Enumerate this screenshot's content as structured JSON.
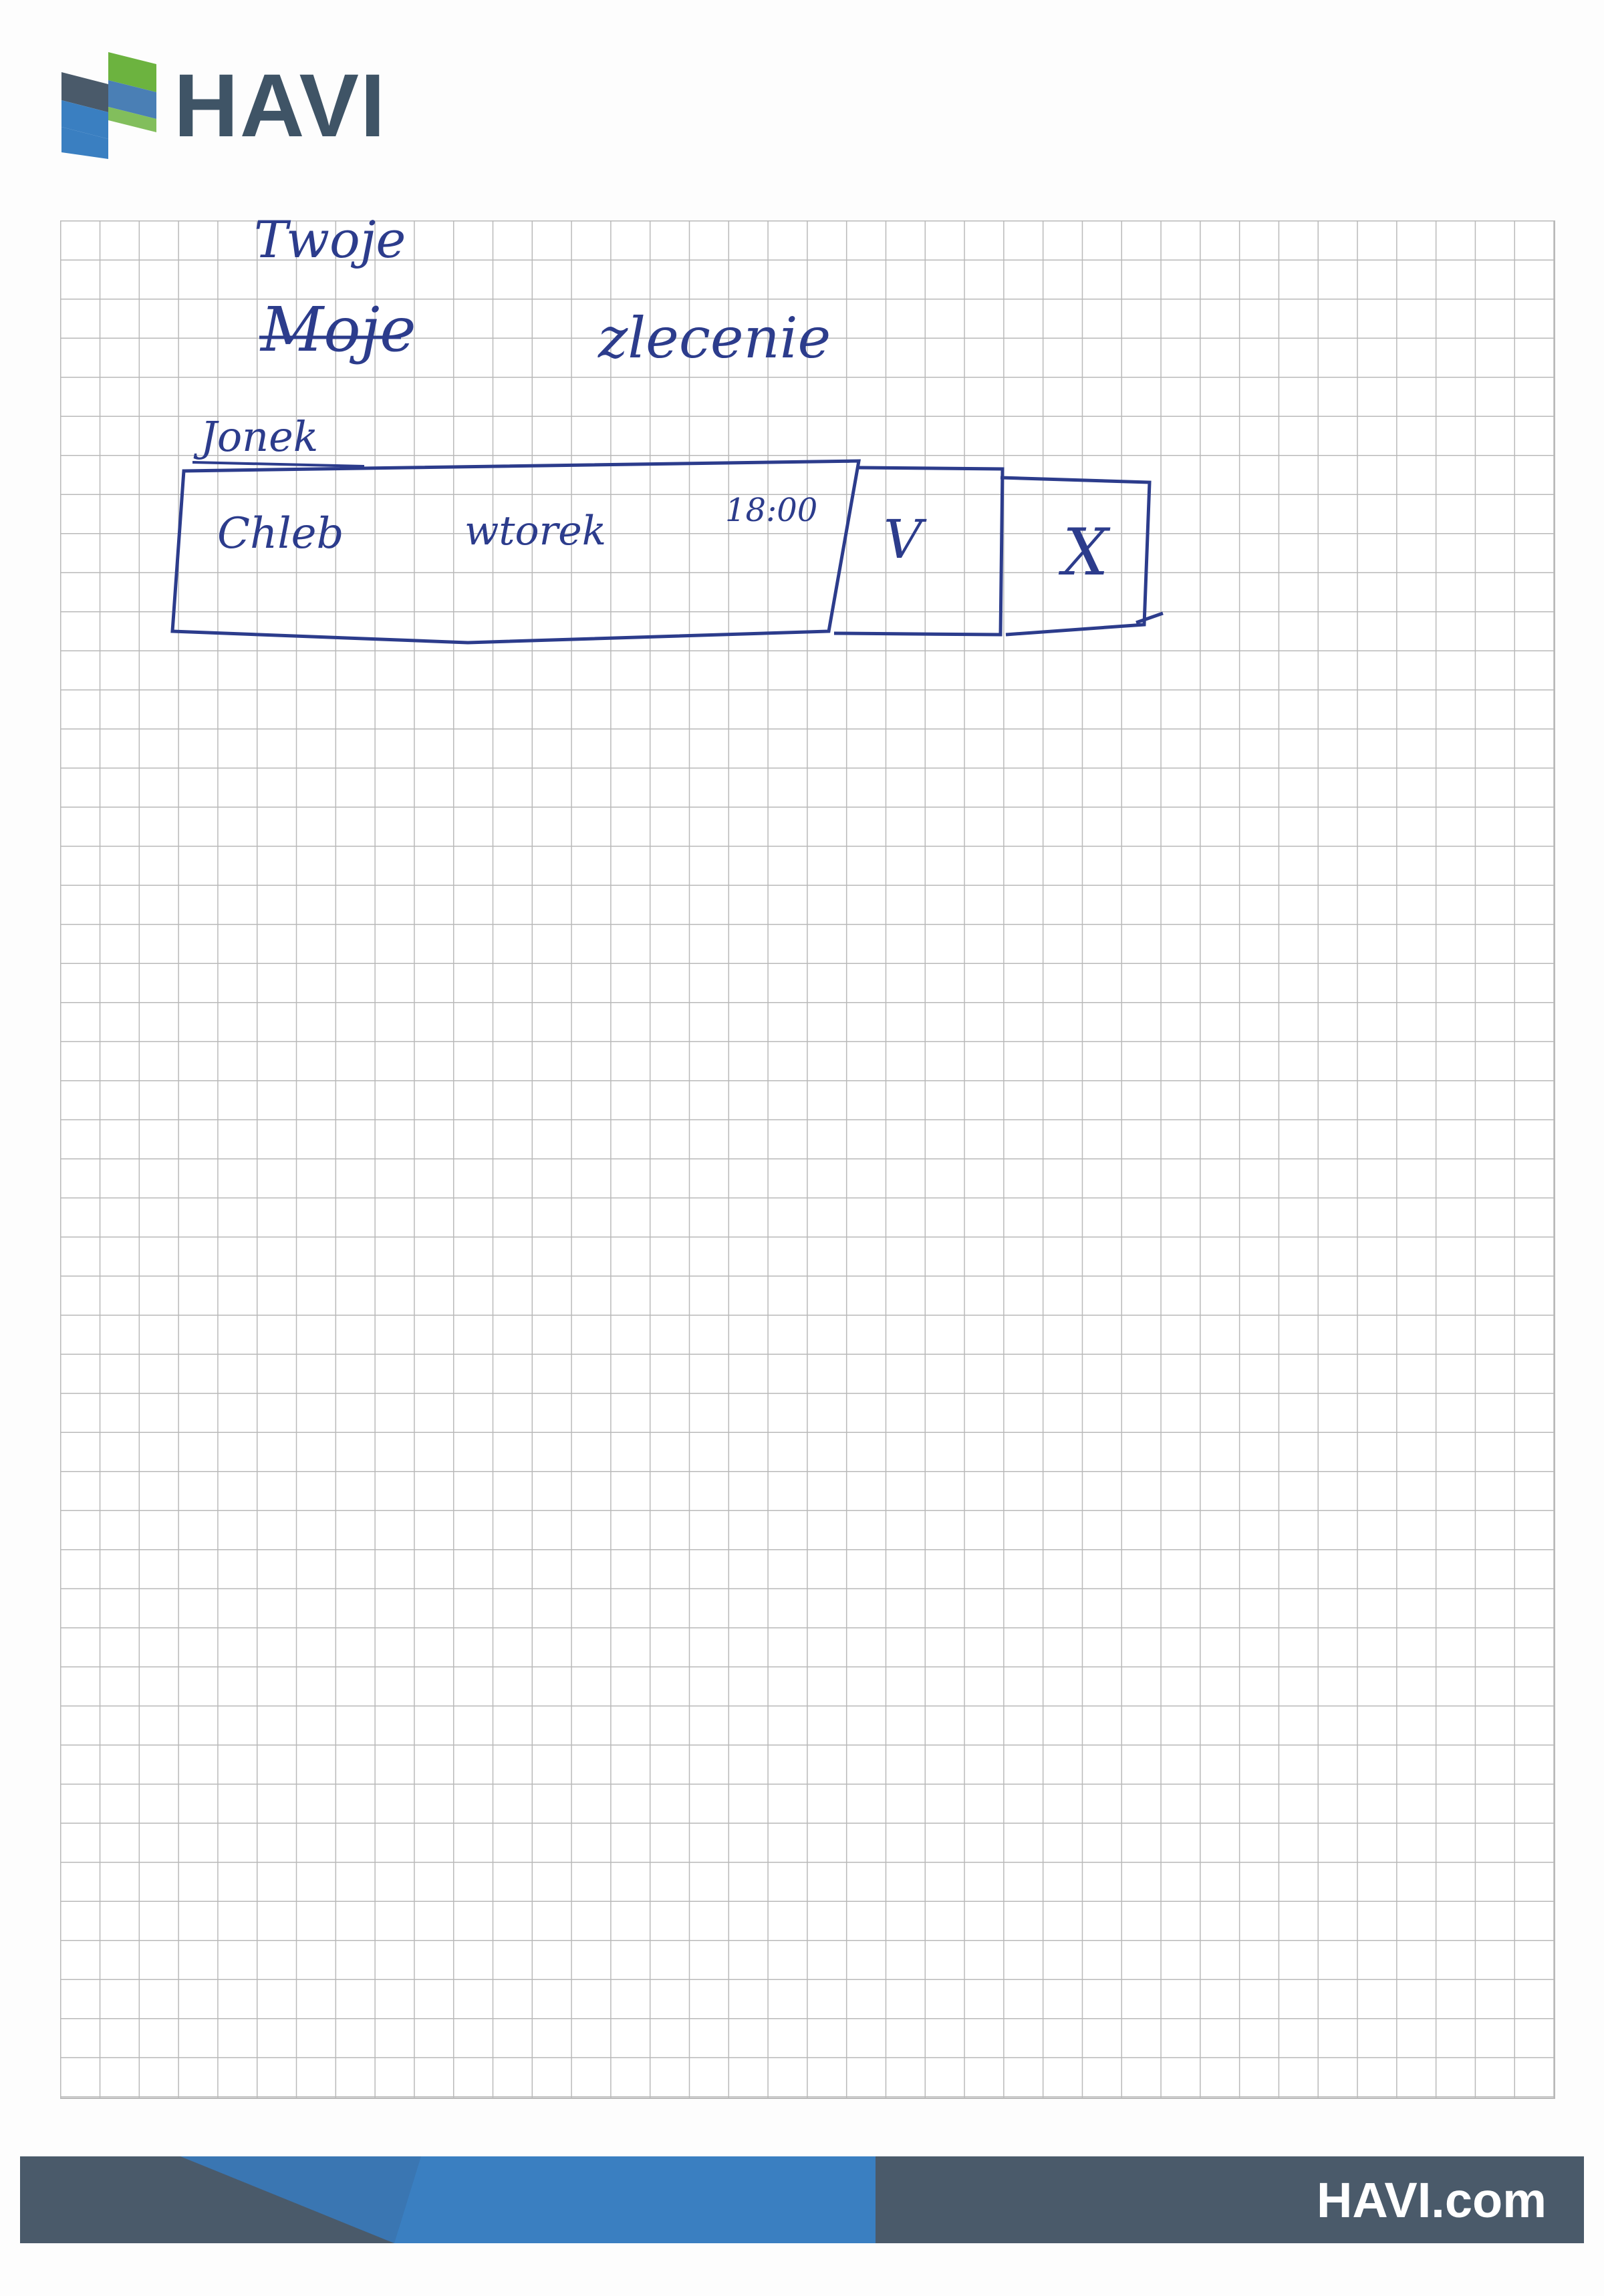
{
  "brand": {
    "logo_text": "HAVI",
    "footer_text": "HAVI.com",
    "colors": {
      "green": "#6cb33f",
      "blue": "#3a7fc1",
      "slate": "#4a5a6a",
      "ink": "#2c3c8c"
    }
  },
  "sketch": {
    "title_line1": "Twoje",
    "title_struck": "Moje",
    "title_word": "zlecenie",
    "section_label": "Jonek",
    "row": {
      "item": "Chleb",
      "day": "wtorek",
      "time": "18:00",
      "accept_mark": "V",
      "reject_mark": "X"
    }
  }
}
